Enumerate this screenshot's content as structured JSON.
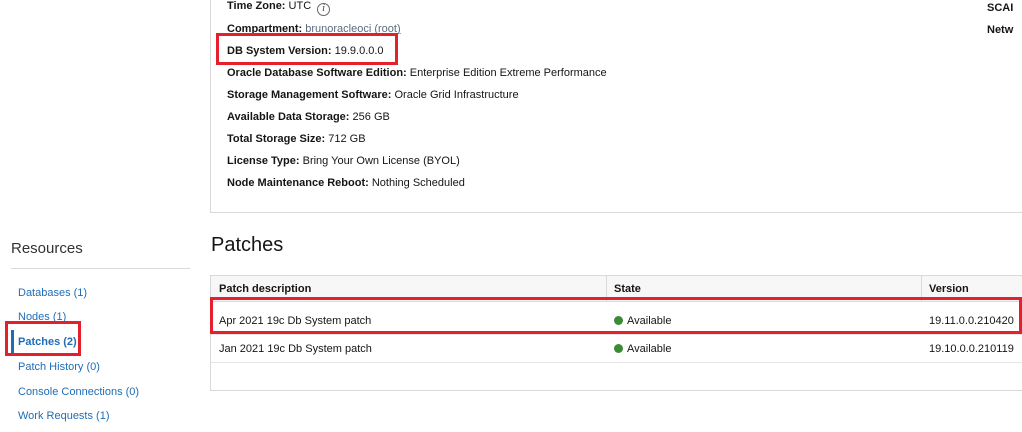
{
  "info": {
    "time_zone_label": "Time Zone:",
    "time_zone_value": "UTC",
    "compartment_label": "Compartment:",
    "compartment_value": "brunoracleoci (root)",
    "db_version_label": "DB System Version:",
    "db_version_value": "19.9.0.0.0",
    "edition_label": "Oracle Database Software Edition:",
    "edition_value": "Enterprise Edition Extreme Performance",
    "storage_mgmt_label": "Storage Management Software:",
    "storage_mgmt_value": "Oracle Grid Infrastructure",
    "avail_storage_label": "Available Data Storage:",
    "avail_storage_value": "256 GB",
    "total_storage_label": "Total Storage Size:",
    "total_storage_value": "712 GB",
    "license_label": "License Type:",
    "license_value": "Bring Your Own License (BYOL)",
    "reboot_label": "Node Maintenance Reboot:",
    "reboot_value": "Nothing Scheduled",
    "right_label_1": "SCAI",
    "right_label_2": "Netw"
  },
  "resources": {
    "heading": "Resources",
    "items": [
      {
        "label": "Databases (1)"
      },
      {
        "label": "Nodes (1)"
      },
      {
        "label": "Patches (2)",
        "active": true
      },
      {
        "label": "Patch History (0)"
      },
      {
        "label": "Console Connections (0)"
      },
      {
        "label": "Work Requests (1)"
      }
    ]
  },
  "patches": {
    "title": "Patches",
    "columns": [
      "Patch description",
      "State",
      "Version"
    ],
    "rows": [
      {
        "description": "Apr 2021 19c Db System patch",
        "state": "Available",
        "version": "19.11.0.0.210420"
      },
      {
        "description": "Jan 2021 19c Db System patch",
        "state": "Available",
        "version": "19.10.0.0.210119"
      }
    ]
  },
  "colors": {
    "link": "#1f6db6",
    "available_dot": "#3a8a36",
    "highlight": "#e3202b"
  }
}
